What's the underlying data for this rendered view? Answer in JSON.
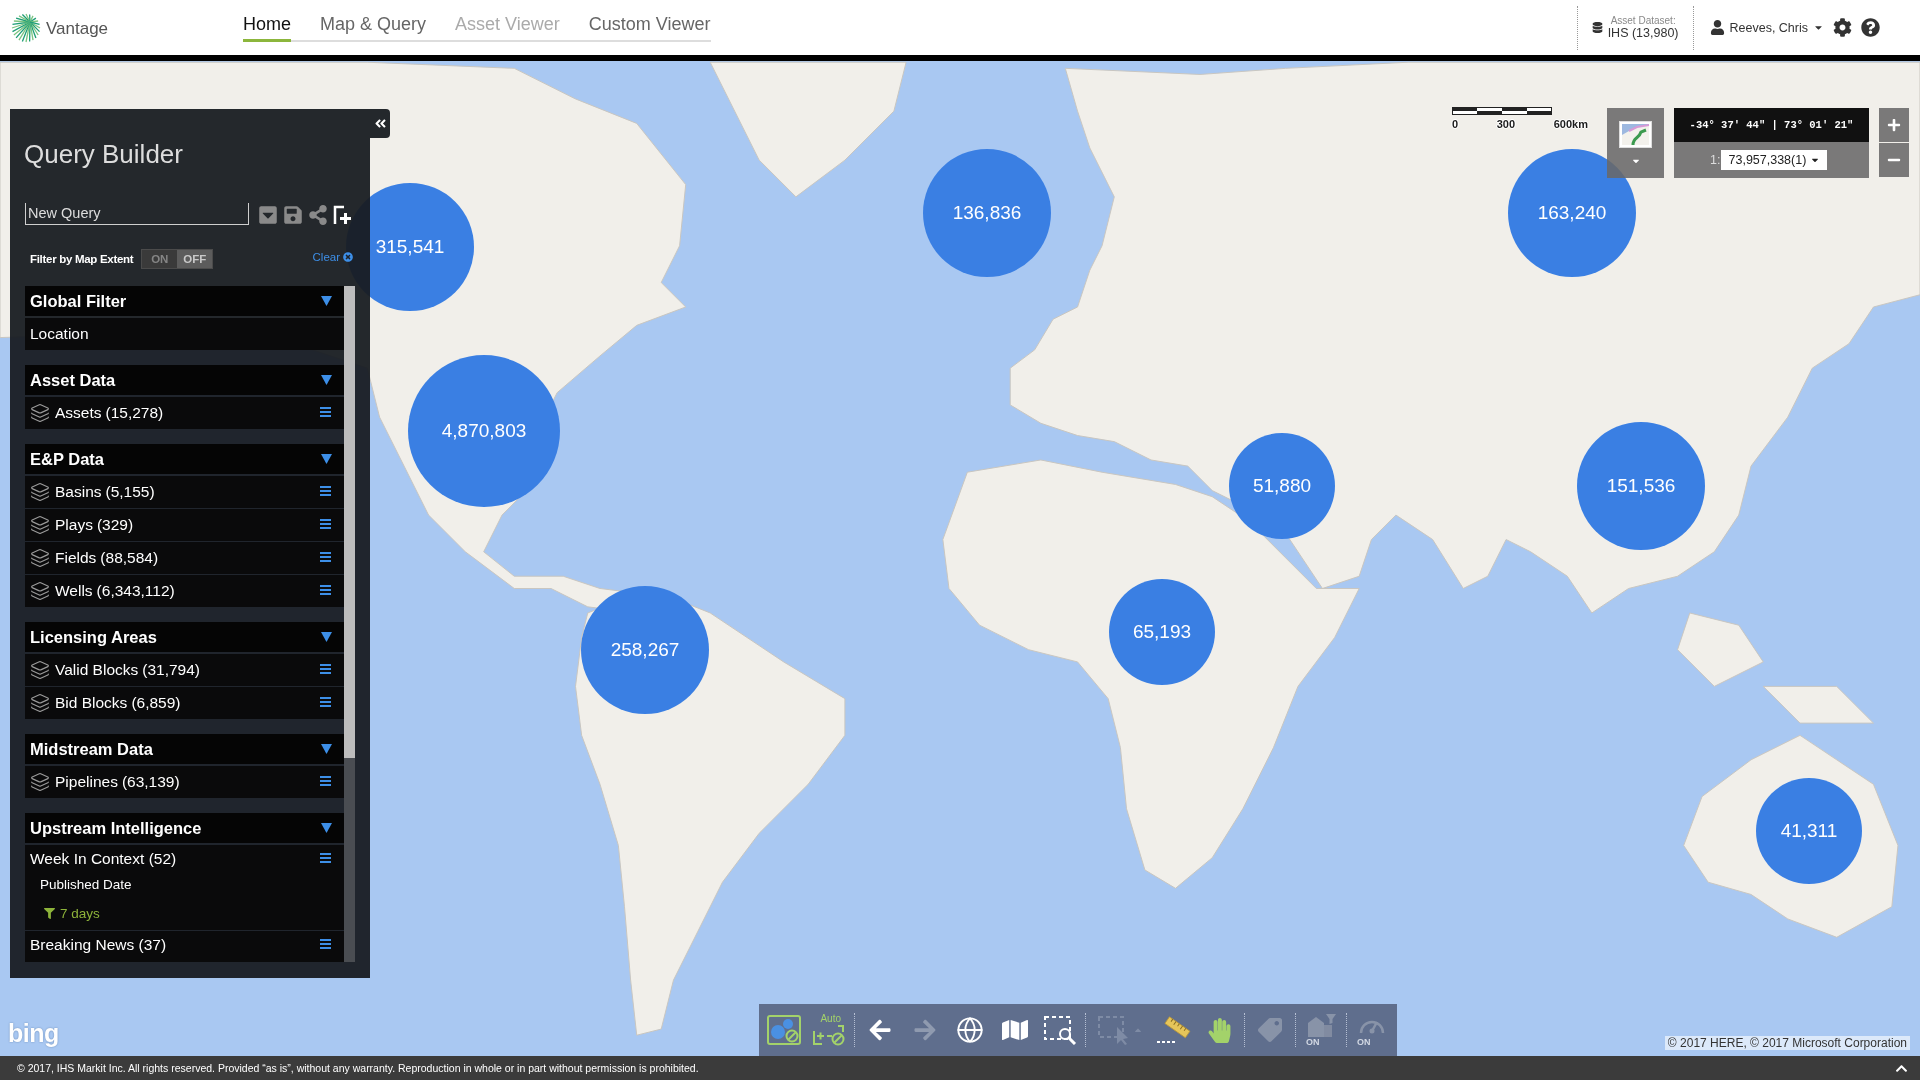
{
  "app": {
    "name": "Vantage"
  },
  "nav_tabs": [
    {
      "label": "Home",
      "selected": true,
      "disabled": false
    },
    {
      "label": "Map & Query",
      "selected": false,
      "disabled": false
    },
    {
      "label": "Asset Viewer",
      "selected": false,
      "disabled": true
    },
    {
      "label": "Custom Viewer",
      "selected": false,
      "disabled": false
    }
  ],
  "dataset": {
    "label": "Asset Dataset:",
    "value": "IHS (13,980)"
  },
  "user": {
    "name": "Reeves, Chris"
  },
  "query_builder": {
    "title": "Query Builder",
    "query_name": {
      "value": "New Query"
    },
    "map_extent_filter": {
      "label": "Filter by Map Extent",
      "options": [
        {
          "label": "ON",
          "selected": false
        },
        {
          "label": "OFF",
          "selected": true
        }
      ]
    },
    "clear_link": "Clear",
    "sections": [
      {
        "title": "Global Filter",
        "expanded": true,
        "items": [
          {
            "kind": "filter",
            "label": "Location"
          }
        ]
      },
      {
        "title": "Asset Data",
        "expanded": true,
        "items": [
          {
            "kind": "layer",
            "label": "Assets",
            "count": "(15,278)"
          }
        ]
      },
      {
        "title": "E&P Data",
        "expanded": true,
        "items": [
          {
            "kind": "layer",
            "label": "Basins",
            "count": "(5,155)"
          },
          {
            "kind": "layer",
            "label": "Plays",
            "count": "(329)"
          },
          {
            "kind": "layer",
            "label": "Fields",
            "count": "(88,584)"
          },
          {
            "kind": "layer",
            "label": "Wells",
            "count": "(6,343,112)"
          }
        ]
      },
      {
        "title": "Licensing Areas",
        "expanded": true,
        "items": [
          {
            "kind": "layer",
            "label": "Valid Blocks",
            "count": "(31,794)"
          },
          {
            "kind": "layer",
            "label": "Bid Blocks",
            "count": "(6,859)"
          }
        ]
      },
      {
        "title": "Midstream Data",
        "expanded": true,
        "items": [
          {
            "kind": "layer",
            "label": "Pipelines",
            "count": "(63,139)"
          }
        ]
      },
      {
        "title": "Upstream Intelligence",
        "expanded": true,
        "items": [
          {
            "kind": "feed",
            "label": "Week In Context",
            "count": "(52)",
            "filters": [
              {
                "name": "Published Date",
                "value": "7 days"
              }
            ]
          },
          {
            "kind": "feed",
            "label": "Breaking News",
            "count": "(37)"
          }
        ]
      }
    ]
  },
  "map": {
    "scale_bar": [
      "0",
      "300",
      "600km"
    ],
    "coordinates": "-34° 37' 44\" | 73° 01' 21\"",
    "scale": {
      "prefix": "1:",
      "value": "73,957,338(1)"
    },
    "clusters": [
      {
        "count": "315,541"
      },
      {
        "count": "136,836"
      },
      {
        "count": "163,240"
      },
      {
        "count": "4,870,803"
      },
      {
        "count": "51,880"
      },
      {
        "count": "151,536"
      },
      {
        "count": "258,267"
      },
      {
        "count": "65,193"
      },
      {
        "count": "41,311"
      }
    ],
    "provider_logo": "bing",
    "attribution": "© 2017 HERE, © 2017 Microsoft Corporation"
  },
  "toolbar": {
    "groups": [
      [
        {
          "kind": "cluster",
          "disabled": false
        },
        {
          "kind": "auto_cluster",
          "label": "Auto",
          "disabled": false
        }
      ],
      [
        {
          "kind": "back",
          "disabled": false
        },
        {
          "kind": "forward",
          "disabled": true
        },
        {
          "kind": "globe",
          "disabled": false
        },
        {
          "kind": "map",
          "disabled": false
        },
        {
          "kind": "zoom_box",
          "disabled": false
        }
      ],
      [
        {
          "kind": "select",
          "disabled": true
        },
        {
          "kind": "measure",
          "disabled": false
        },
        {
          "kind": "pan",
          "disabled": false
        }
      ],
      [
        {
          "kind": "tag",
          "disabled": true
        }
      ],
      [
        {
          "kind": "building_filter",
          "label": "ON",
          "disabled": true
        }
      ],
      [
        {
          "kind": "gauge",
          "label": "ON",
          "disabled": true
        }
      ]
    ]
  },
  "footer": {
    "copyright": "© 2017, IHS Markit Inc. All rights reserved. Provided “as is”, without any warranty. Reproduction in whole or in part without permission is prohibited."
  }
}
